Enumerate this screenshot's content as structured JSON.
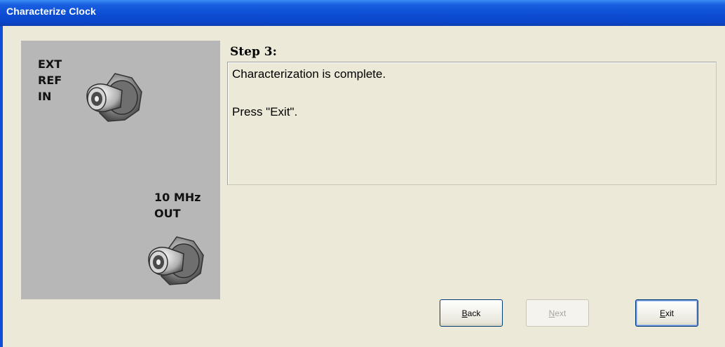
{
  "window": {
    "title": "Characterize Clock"
  },
  "panel": {
    "ext_label": "EXT\nREF\nIN",
    "out_label": "10 MHz\nOUT",
    "background": "#b7b7b7"
  },
  "step": {
    "title": "Step 3:",
    "line1": "Characterization is complete.",
    "line2": "Press \"Exit\"."
  },
  "buttons": {
    "back": {
      "mnemonic": "B",
      "rest": "ack",
      "enabled": true
    },
    "next": {
      "mnemonic": "N",
      "rest": "ext",
      "enabled": false
    },
    "exit": {
      "mnemonic": "E",
      "rest": "xit",
      "enabled": true,
      "default": true
    }
  },
  "colors": {
    "titlebar": "#0d4fd6",
    "dialog_bg": "#ece9d8"
  }
}
